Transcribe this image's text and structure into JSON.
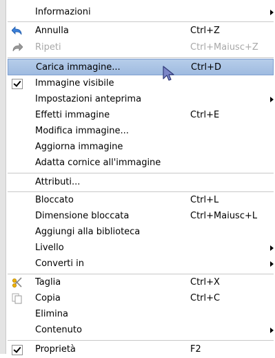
{
  "menu": {
    "items": [
      {
        "label": "Informazioni",
        "accel": "",
        "submenu": true
      },
      {
        "label": "Annulla",
        "accel": "Ctrl+Z",
        "icon": "undo-icon"
      },
      {
        "label": "Ripeti",
        "accel": "Ctrl+Maiusc+Z",
        "icon": "redo-icon",
        "disabled": true
      },
      {
        "label": "Carica immagine...",
        "accel": "Ctrl+D",
        "highlighted": true
      },
      {
        "label": "Immagine visibile",
        "accel": "",
        "checked": true
      },
      {
        "label": "Impostazioni anteprima",
        "accel": "",
        "submenu": true
      },
      {
        "label": "Effetti immagine",
        "accel": "Ctrl+E"
      },
      {
        "label": "Modifica immagine...",
        "accel": ""
      },
      {
        "label": "Aggiorna immagine",
        "accel": ""
      },
      {
        "label": "Adatta cornice all'immagine",
        "accel": ""
      },
      {
        "label": "Attributi...",
        "accel": ""
      },
      {
        "label": "Bloccato",
        "accel": "Ctrl+L"
      },
      {
        "label": "Dimensione bloccata",
        "accel": "Ctrl+Maiusc+L"
      },
      {
        "label": "Aggiungi alla biblioteca",
        "accel": ""
      },
      {
        "label": "Livello",
        "accel": "",
        "submenu": true
      },
      {
        "label": "Converti in",
        "accel": "",
        "submenu": true
      },
      {
        "label": "Taglia",
        "accel": "Ctrl+X",
        "icon": "scissors-icon"
      },
      {
        "label": "Copia",
        "accel": "Ctrl+C",
        "icon": "copy-icon"
      },
      {
        "label": "Elimina",
        "accel": ""
      },
      {
        "label": "Contenuto",
        "accel": "",
        "submenu": true
      },
      {
        "label": "Proprietà",
        "accel": "F2",
        "checked": true
      }
    ]
  }
}
